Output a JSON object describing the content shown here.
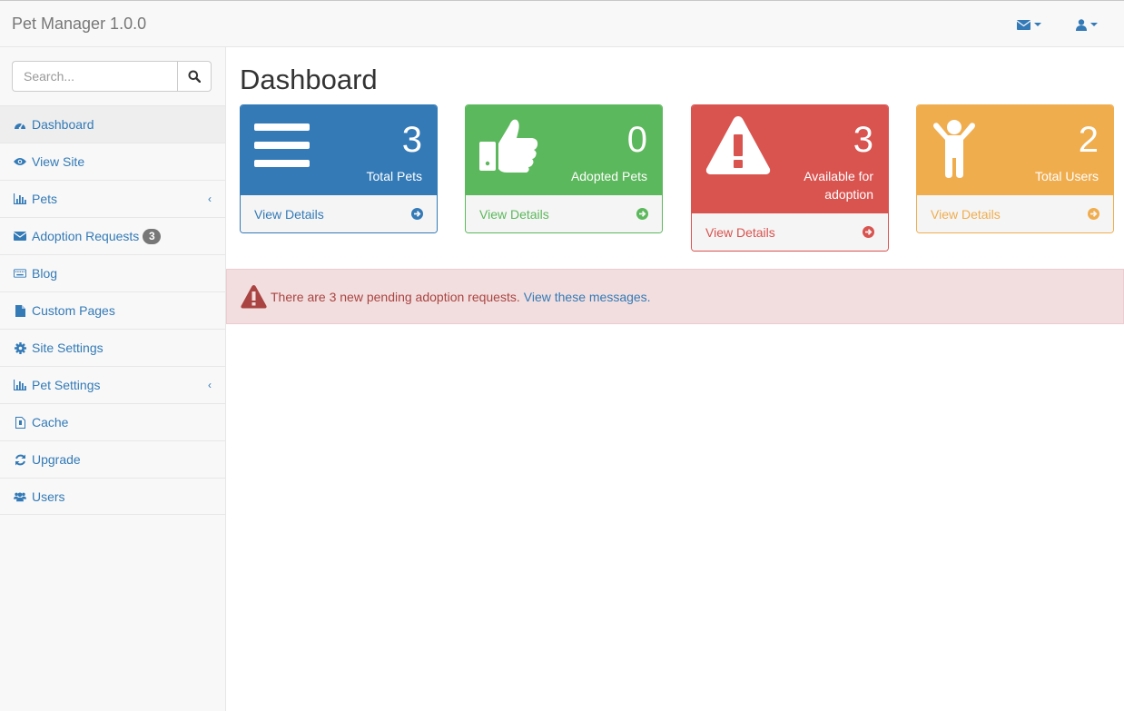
{
  "navbar": {
    "brand": "Pet Manager 1.0.0",
    "messages_icon": "envelope-icon",
    "user_icon": "user-icon"
  },
  "sidebar": {
    "search": {
      "placeholder": "Search...",
      "value": ""
    },
    "items": [
      {
        "label": "Dashboard",
        "icon": "dashboard-icon",
        "active": true
      },
      {
        "label": "View Site",
        "icon": "eye-icon"
      },
      {
        "label": "Pets",
        "icon": "bar-chart-icon",
        "expandable": true
      },
      {
        "label": "Adoption Requests",
        "icon": "envelope-icon",
        "badge": "3"
      },
      {
        "label": "Blog",
        "icon": "keyboard-icon"
      },
      {
        "label": "Custom Pages",
        "icon": "file-icon"
      },
      {
        "label": "Site Settings",
        "icon": "gear-icon"
      },
      {
        "label": "Pet Settings",
        "icon": "bar-chart-icon",
        "expandable": true
      },
      {
        "label": "Cache",
        "icon": "file-cache-icon"
      },
      {
        "label": "Upgrade",
        "icon": "refresh-icon"
      },
      {
        "label": "Users",
        "icon": "users-icon"
      }
    ]
  },
  "main": {
    "title": "Dashboard",
    "panels": [
      {
        "value": "3",
        "label": "Total Pets",
        "footer": "View Details",
        "color": "#337ab7",
        "icon": "list-icon"
      },
      {
        "value": "0",
        "label": "Adopted Pets",
        "footer": "View Details",
        "color": "#5cb85c",
        "icon": "thumbs-up-icon"
      },
      {
        "value": "3",
        "label": "Available for adoption",
        "footer": "View Details",
        "color": "#d9534f",
        "icon": "warning-icon"
      },
      {
        "value": "2",
        "label": "Total Users",
        "footer": "View Details",
        "color": "#f0ad4e",
        "icon": "child-icon"
      }
    ],
    "alert": {
      "text": "There are 3 new pending adoption requests.",
      "link": "View these messages."
    }
  }
}
